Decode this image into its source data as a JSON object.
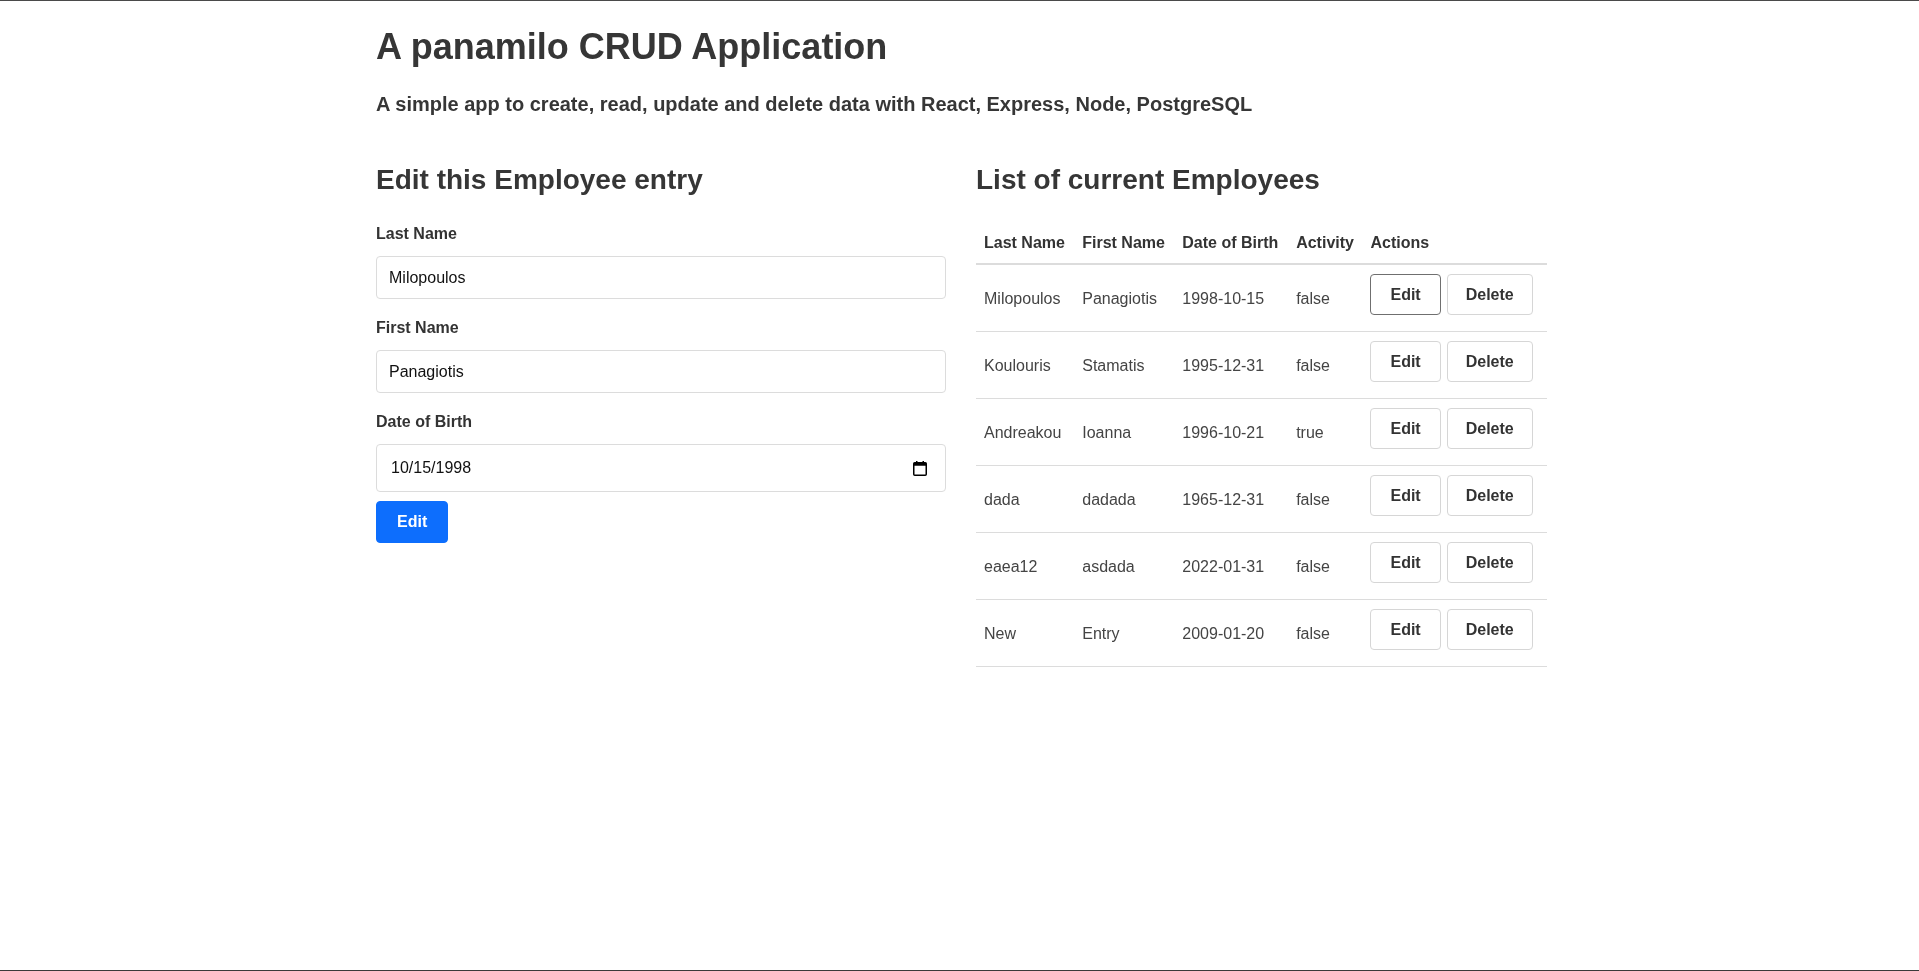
{
  "header": {
    "title": "A panamilo CRUD Application",
    "subtitle": "A simple app to create, read, update and delete data with React, Express, Node, PostgreSQL"
  },
  "form": {
    "heading": "Edit this Employee entry",
    "fields": [
      {
        "kind": "text",
        "label": "Last Name",
        "value": "Milopoulos"
      },
      {
        "kind": "text",
        "label": "First Name",
        "value": "Panagiotis"
      },
      {
        "kind": "date",
        "label": "Date of Birth",
        "value": "10/15/1998"
      }
    ],
    "submit": "Edit"
  },
  "list": {
    "heading": "List of current Employees",
    "table": {
      "columns": [
        "Last Name",
        "First Name",
        "Date of Birth",
        "Activity",
        "Actions"
      ],
      "rows": [
        {
          "cells": [
            "Milopoulos",
            "Panagiotis",
            "1998-10-15",
            "false"
          ],
          "actions": [
            {
              "kind": "edit",
              "label": "Edit",
              "focused": true
            },
            {
              "kind": "delete",
              "label": "Delete",
              "focused": false
            }
          ]
        },
        {
          "cells": [
            "Koulouris",
            "Stamatis",
            "1995-12-31",
            "false"
          ],
          "actions": [
            {
              "kind": "edit",
              "label": "Edit",
              "focused": false
            },
            {
              "kind": "delete",
              "label": "Delete",
              "focused": false
            }
          ]
        },
        {
          "cells": [
            "Andreakou",
            "Ioanna",
            "1996-10-21",
            "true"
          ],
          "actions": [
            {
              "kind": "edit",
              "label": "Edit",
              "focused": false
            },
            {
              "kind": "delete",
              "label": "Delete",
              "focused": false
            }
          ]
        },
        {
          "cells": [
            "dada",
            "dadada",
            "1965-12-31",
            "false"
          ],
          "actions": [
            {
              "kind": "edit",
              "label": "Edit",
              "focused": false
            },
            {
              "kind": "delete",
              "label": "Delete",
              "focused": false
            }
          ]
        },
        {
          "cells": [
            "eaea12",
            "asdada",
            "2022-01-31",
            "false"
          ],
          "actions": [
            {
              "kind": "edit",
              "label": "Edit",
              "focused": false
            },
            {
              "kind": "delete",
              "label": "Delete",
              "focused": false
            }
          ]
        },
        {
          "cells": [
            "New",
            "Entry",
            "2009-01-20",
            "false"
          ],
          "actions": [
            {
              "kind": "edit",
              "label": "Edit",
              "focused": false
            },
            {
              "kind": "delete",
              "label": "Delete",
              "focused": false
            }
          ]
        }
      ]
    }
  }
}
